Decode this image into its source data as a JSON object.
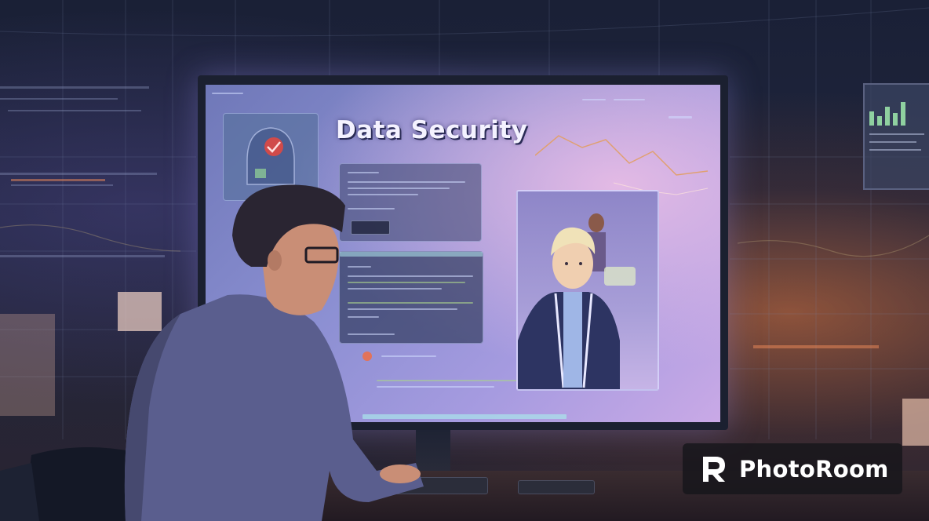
{
  "screen": {
    "title": "Data Security"
  },
  "watermark": {
    "text": "PhotoRoom",
    "icon": "photoroom-logo-icon"
  },
  "colors": {
    "screen_glow": "#8b8fd2",
    "accent_orange": "#e6783c",
    "background": "#141a2c"
  }
}
